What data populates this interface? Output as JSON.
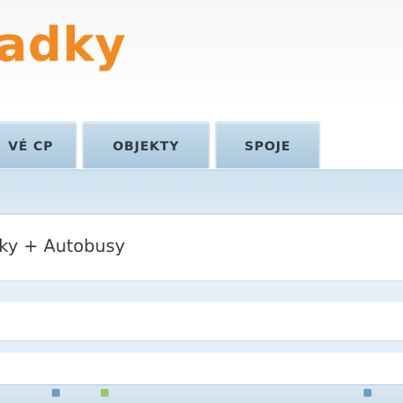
{
  "logo": {
    "text": "adky",
    "color": "#f28a22"
  },
  "tabs": [
    {
      "label": "VÉ CP"
    },
    {
      "label": "OBJEKTY"
    },
    {
      "label": "SPOJE"
    }
  ],
  "main": {
    "selected_value": "ky + Autobusy"
  },
  "colors": {
    "tab_bg": "#b6d0e2",
    "band_bg": "#dcebf5",
    "accent": "#f28a22"
  },
  "footer": {
    "icons": [
      "blue-icon",
      "green-icon",
      "blue-icon"
    ]
  }
}
